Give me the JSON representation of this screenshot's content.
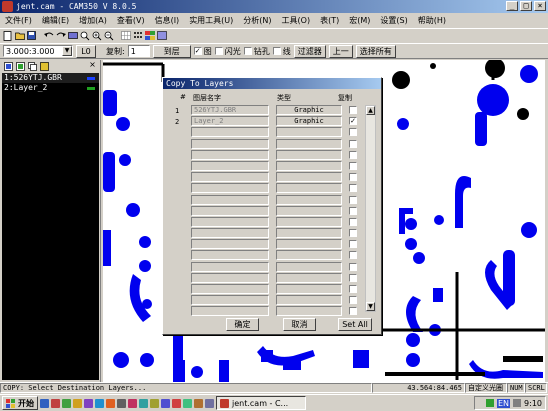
{
  "window": {
    "title": "jent.cam - CAM350 V 8.0.5",
    "min": "_",
    "max": "□",
    "close": "×"
  },
  "menu": [
    "文件(F)",
    "编辑(E)",
    "增加(A)",
    "查看(V)",
    "信息(I)",
    "实用工具(U)",
    "分析(N)",
    "工具(O)",
    "表(T)",
    "宏(M)",
    "设置(S)",
    "帮助(H)"
  ],
  "toolbar2": {
    "coords": "3.000:3.000",
    "l0": "L0",
    "copy_label": "复制:",
    "copy_value": "1",
    "to_layer_button": "到层",
    "opt1": "图",
    "opt2": "闪光",
    "opt3": "钻孔",
    "opt4": "线",
    "filter_button": "过滤器",
    "prev_button": "上一",
    "select_all_button": "选择所有"
  },
  "left_panel": {
    "close": "×",
    "layers": [
      {
        "name": "1:526YTJ.GBR",
        "color": "#1a40ff"
      },
      {
        "name": "2:Layer_2",
        "color": "#20a020"
      }
    ]
  },
  "dialog": {
    "title": "Copy To Layers",
    "headers": {
      "num": "#",
      "layer_name": "图层名字",
      "type": "类型",
      "copy": "复制"
    },
    "rows": [
      {
        "num": "1",
        "name": "526YTJ.GBR",
        "type": "Graphic",
        "checked": false
      },
      {
        "num": "2",
        "name": "Layer_2",
        "type": "Graphic",
        "checked": true
      },
      {
        "num": "",
        "name": "",
        "type": "",
        "checked": false
      },
      {
        "num": "",
        "name": "",
        "type": "",
        "checked": false
      },
      {
        "num": "",
        "name": "",
        "type": "",
        "checked": false
      },
      {
        "num": "",
        "name": "",
        "type": "",
        "checked": false
      },
      {
        "num": "",
        "name": "",
        "type": "",
        "checked": false
      },
      {
        "num": "",
        "name": "",
        "type": "",
        "checked": false
      },
      {
        "num": "",
        "name": "",
        "type": "",
        "checked": false
      },
      {
        "num": "",
        "name": "",
        "type": "",
        "checked": false
      },
      {
        "num": "",
        "name": "",
        "type": "",
        "checked": false
      },
      {
        "num": "",
        "name": "",
        "type": "",
        "checked": false
      },
      {
        "num": "",
        "name": "",
        "type": "",
        "checked": false
      },
      {
        "num": "",
        "name": "",
        "type": "",
        "checked": false
      },
      {
        "num": "",
        "name": "",
        "type": "",
        "checked": false
      },
      {
        "num": "",
        "name": "",
        "type": "",
        "checked": false
      },
      {
        "num": "",
        "name": "",
        "type": "",
        "checked": false
      },
      {
        "num": "",
        "name": "",
        "type": "",
        "checked": false
      },
      {
        "num": "",
        "name": "",
        "type": "",
        "checked": false
      }
    ],
    "ok_button": "确定",
    "cancel_button": "取消",
    "set_all_button": "Set All"
  },
  "status": {
    "message": "COPY: Select Destination Layers...",
    "coords": "43.564:84.465",
    "grid": "自定义光圈",
    "num": "NUM",
    "scrl": "SCRL"
  },
  "taskbar": {
    "start": "开始",
    "task": "jent.cam - C...",
    "ime": "EN",
    "clock": "9:10"
  },
  "colors": {
    "pcb_blue": "#0000ee",
    "pcb_black": "#000000",
    "title_blue": "#0a246a"
  }
}
